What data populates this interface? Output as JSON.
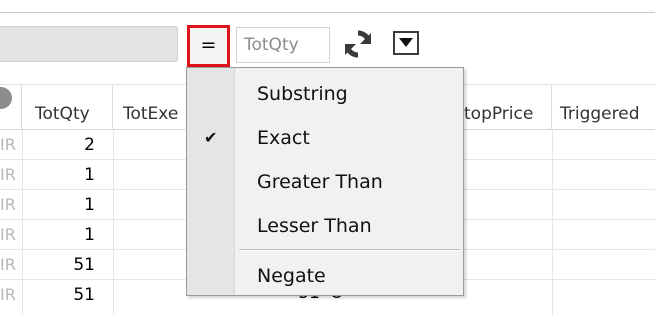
{
  "toolbar": {
    "operator_label": "=",
    "column_input_value": "TotQty",
    "refresh_icon": "refresh-icon",
    "dropdown_icon": "dropdown-arrow-icon"
  },
  "grid": {
    "headers": {
      "totqty": "TotQty",
      "totexe": "TotExe",
      "stopprice": "topPrice",
      "triggered": "Triggered"
    },
    "rows": [
      {
        "left": "IR",
        "totqty": "2"
      },
      {
        "left": "IR",
        "totqty": "1"
      },
      {
        "left": "IR",
        "totqty": "1"
      },
      {
        "left": "IR",
        "totqty": "1"
      },
      {
        "left": "IR",
        "totqty": "51"
      },
      {
        "left": "IR",
        "totqty": "51",
        "totexe": "51",
        "extra": "O"
      }
    ]
  },
  "menu": {
    "items": [
      {
        "label": "Substring",
        "checked": false
      },
      {
        "label": "Exact",
        "checked": true
      },
      {
        "label": "Greater Than",
        "checked": false
      },
      {
        "label": "Lesser Than",
        "checked": false
      },
      {
        "label": "Negate",
        "checked": false
      }
    ],
    "check_glyph": "✔"
  }
}
